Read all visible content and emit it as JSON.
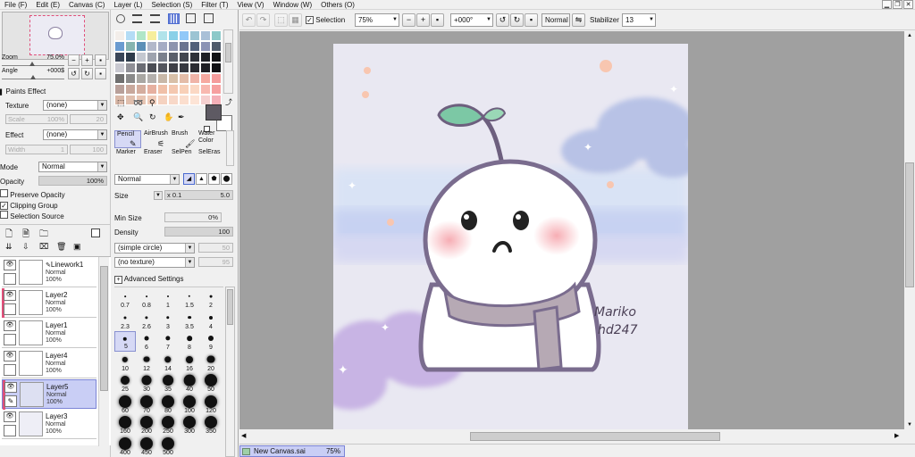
{
  "menu": {
    "file": "File (F)",
    "edit": "Edit (E)",
    "canvas": "Canvas (C)",
    "layer": "Layer (L)",
    "selection": "Selection (S)",
    "filter": "Filter (T)",
    "view": "View (V)",
    "window": "Window (W)",
    "others": "Others (O)"
  },
  "toolbar": {
    "selection_label": "Selection",
    "zoom_value": "75%",
    "rotation_value": "+000°",
    "blend_mode": "Normal",
    "stabilizer_label": "Stabilizer",
    "stabilizer_value": "13"
  },
  "navigator": {
    "zoom_label": "Zoom",
    "zoom_value": "75.0%",
    "angle_label": "Angle",
    "angle_value": "+000$"
  },
  "paints_effect": {
    "title": "Paints Effect",
    "texture_label": "Texture",
    "texture_value": "(none)",
    "scale_label": "Scale",
    "scale_value": "100%",
    "scale_num": "20",
    "effect_label": "Effect",
    "effect_value": "(none)",
    "width_label": "Width",
    "width_value": "1",
    "width_num": "100"
  },
  "layer_props": {
    "mode_label": "Mode",
    "mode_value": "Normal",
    "opacity_label": "Opacity",
    "opacity_value": "100%",
    "preserve_opacity": "Preserve Opacity",
    "clipping_group": "Clipping Group",
    "selection_source": "Selection Source"
  },
  "layers": [
    {
      "name": "Linework1",
      "mode": "Normal",
      "opacity": "100%"
    },
    {
      "name": "Layer2",
      "mode": "Normal",
      "opacity": "100%"
    },
    {
      "name": "Layer1",
      "mode": "Normal",
      "opacity": "100%"
    },
    {
      "name": "Layer4",
      "mode": "Normal",
      "opacity": "100%"
    },
    {
      "name": "Layer5",
      "mode": "Normal",
      "opacity": "100%"
    },
    {
      "name": "Layer3",
      "mode": "Normal",
      "opacity": "100%"
    }
  ],
  "tools": {
    "row1": [
      "Pencil",
      "AirBrush",
      "Brush",
      "Water Color"
    ],
    "row2": [
      "Marker",
      "Eraser",
      "SelPen",
      "SelEras"
    ]
  },
  "brush": {
    "mode_value": "Normal",
    "size_label": "Size",
    "size_mult": "x 0.1",
    "size_value": "5.0",
    "min_size_label": "Min Size",
    "min_size_value": "0%",
    "density_label": "Density",
    "density_value": "100",
    "shape_value": "(simple circle)",
    "shape_num": "50",
    "texture_value": "(no texture)",
    "texture_num": "95",
    "advanced_label": "Advanced Settings",
    "sizes": [
      "0.7",
      "0.8",
      "1",
      "1.5",
      "2",
      "2.3",
      "2.6",
      "3",
      "3.5",
      "4",
      "5",
      "6",
      "7",
      "8",
      "9",
      "10",
      "12",
      "14",
      "16",
      "20",
      "25",
      "30",
      "35",
      "40",
      "50",
      "60",
      "70",
      "80",
      "100",
      "120",
      "160",
      "200",
      "250",
      "300",
      "350",
      "400",
      "450",
      "500"
    ]
  },
  "canvas_art": {
    "signature_line1": "Mariko",
    "signature_line2": "hd247"
  },
  "status": {
    "doc_name": "New Canvas.sai",
    "doc_zoom": "75%"
  },
  "colors": {
    "selected_fg": "#5e5a63",
    "selected_bg": "#ffffff",
    "selection_highlight": "#c9cef5",
    "canvas_bg": "#e9e8f2"
  },
  "swatches": [
    "#f3eeea",
    "#b4dcf5",
    "#b0e6c8",
    "#f6ee9c",
    "#b1e3ea",
    "#8ad0e8",
    "#91c8f8",
    "#9cc4d3",
    "#a9c0d7",
    "#8cc9c9",
    "#6a9bd0",
    "#86b4b0",
    "#5c8fb7",
    "#b2b8ca",
    "#a5acc4",
    "#8c94ae",
    "#6b7490",
    "#51607a",
    "#8b93b5",
    "#4e5a6a",
    "#3a4658",
    "#2e3b4a",
    "#c4c8d0",
    "#9ea3ae",
    "#7b808c",
    "#5a5f6a",
    "#42464f",
    "#2e3138",
    "#1f2126",
    "#111316",
    "#c9c9d1",
    "#8f8f96",
    "#6a6c74",
    "#4b4d55",
    "#54565e",
    "#3f4047",
    "#363840",
    "#2a2b31",
    "#1e1f24",
    "#101114",
    "#6f6f6f",
    "#8a8a8a",
    "#a9a7a3",
    "#b4b0ad",
    "#c8b8a8",
    "#d8c0a8",
    "#e4bca8",
    "#f0b4a8",
    "#f6a9a0",
    "#f49c9c",
    "#b8a09a",
    "#c8a89c",
    "#d4ad9e",
    "#e6b0a0",
    "#f0c0a8",
    "#f4c8b0",
    "#f8d0b8",
    "#fbd8c4",
    "#f8b8b0",
    "#f6a0a0",
    "#d9b8a8",
    "#e0bfae",
    "#e8c6b4",
    "#f0ccba",
    "#f5d2c0",
    "#f8d8c8",
    "#fbdece",
    "#fde4d6",
    "#f6d0d0",
    "#f4b0b8"
  ]
}
